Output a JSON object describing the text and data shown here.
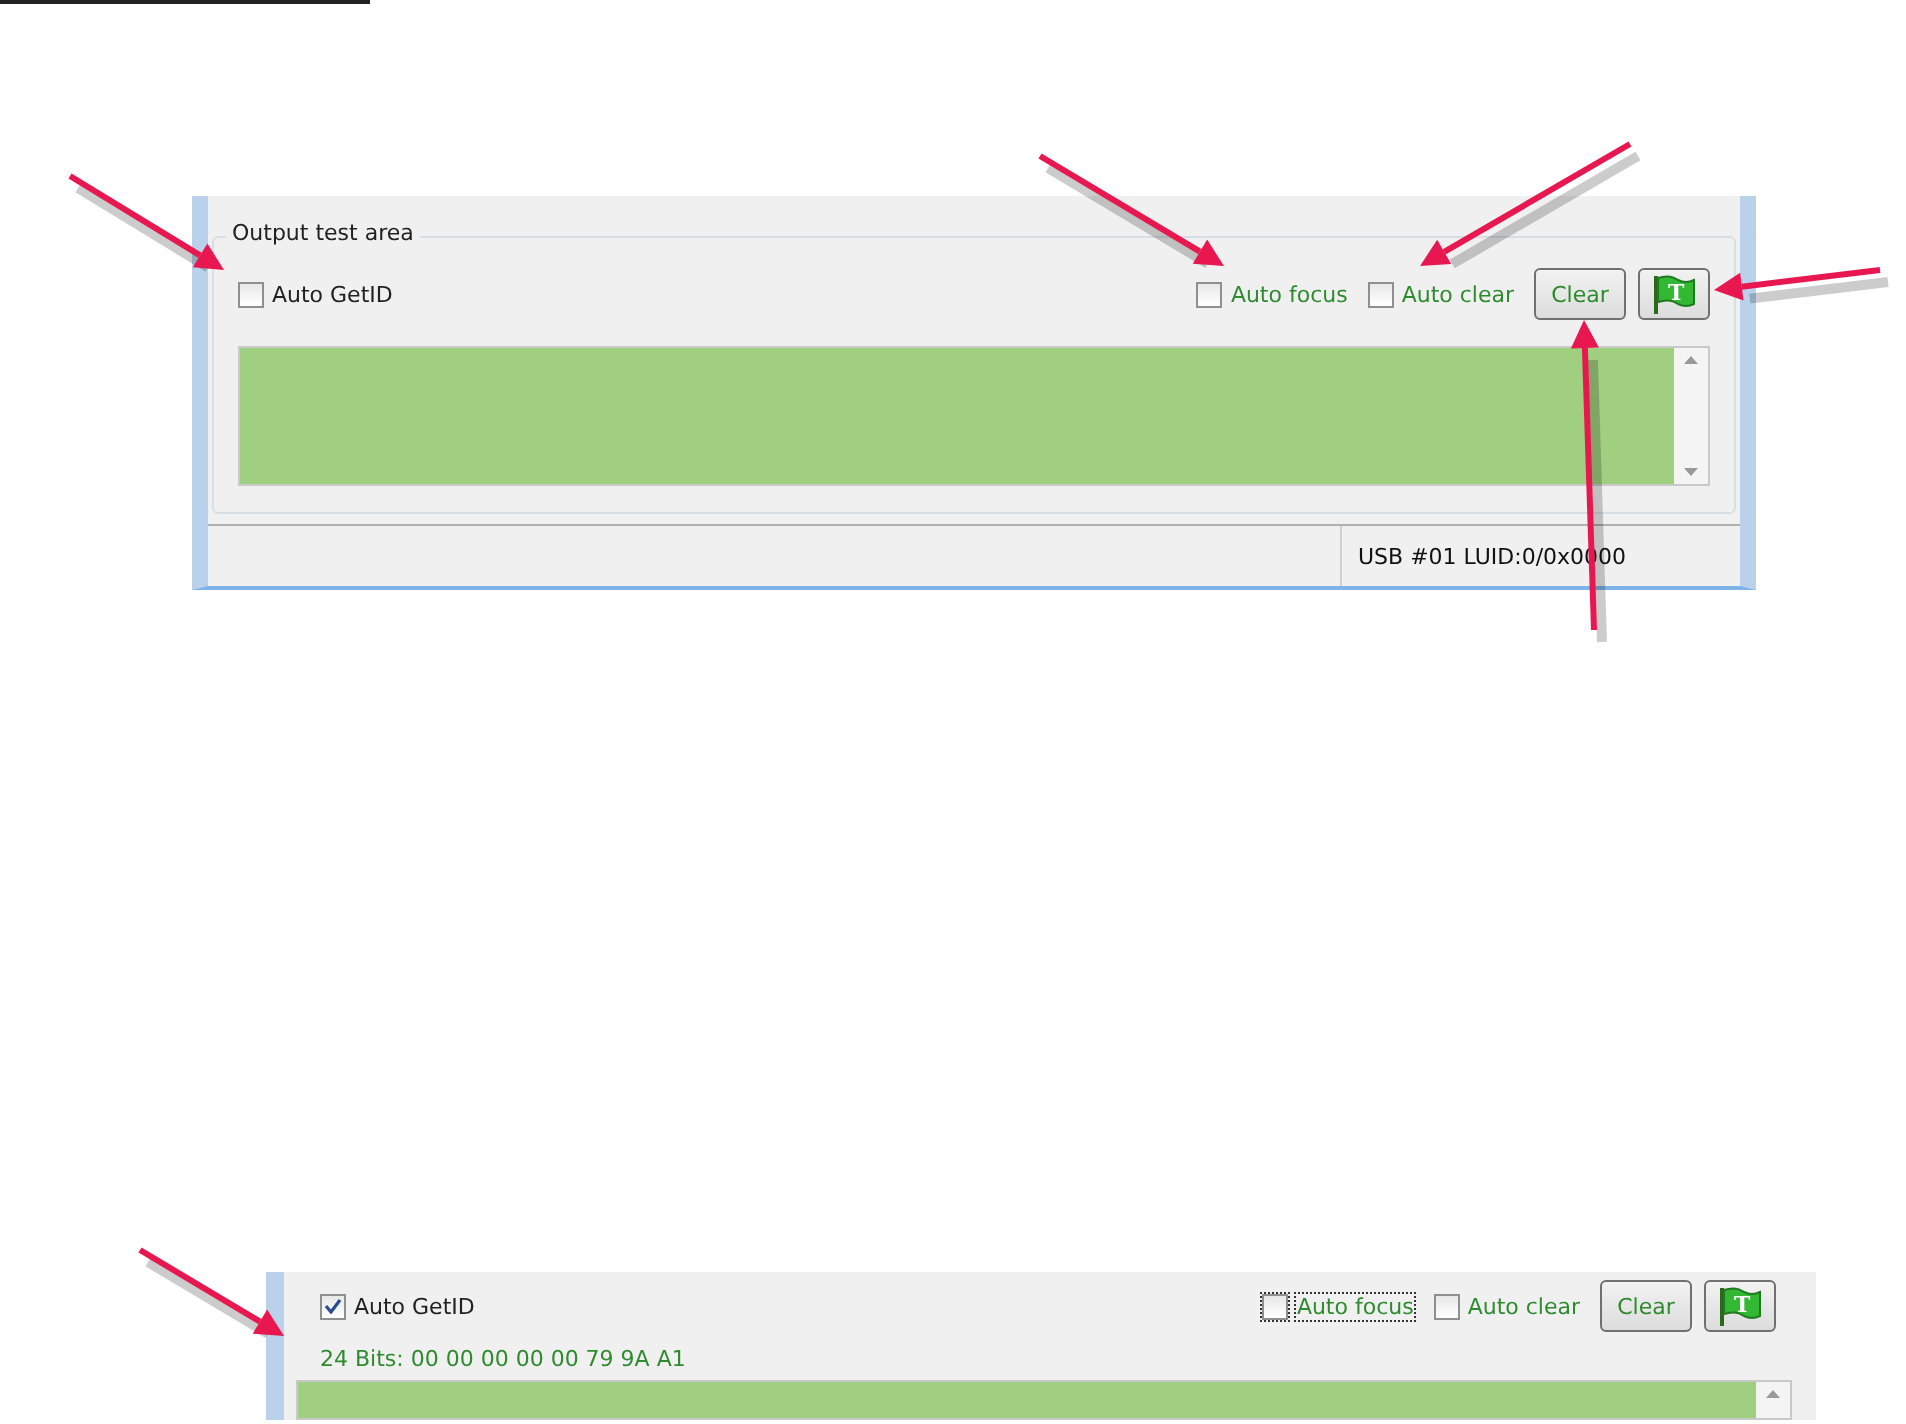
{
  "screenshots": [
    {
      "group_title": "Output test area",
      "auto_getid": {
        "label": "Auto GetID",
        "checked": false
      },
      "options": [
        {
          "label": "Auto focus",
          "checked": false,
          "focused": false
        },
        {
          "label": "Auto clear",
          "checked": false,
          "focused": false
        }
      ],
      "clear_button": "Clear",
      "flag_label": "T",
      "status_bar": "USB #01 LUID:0/0x0000"
    },
    {
      "auto_getid": {
        "label": "Auto GetID",
        "checked": true
      },
      "options": [
        {
          "label": "Auto focus",
          "checked": false,
          "focused": true
        },
        {
          "label": "Auto clear",
          "checked": false,
          "focused": false
        }
      ],
      "clear_button": "Clear",
      "flag_label": "T",
      "output_line": "24 Bits: 00 00 00 00 00 79 9A A1"
    }
  ]
}
